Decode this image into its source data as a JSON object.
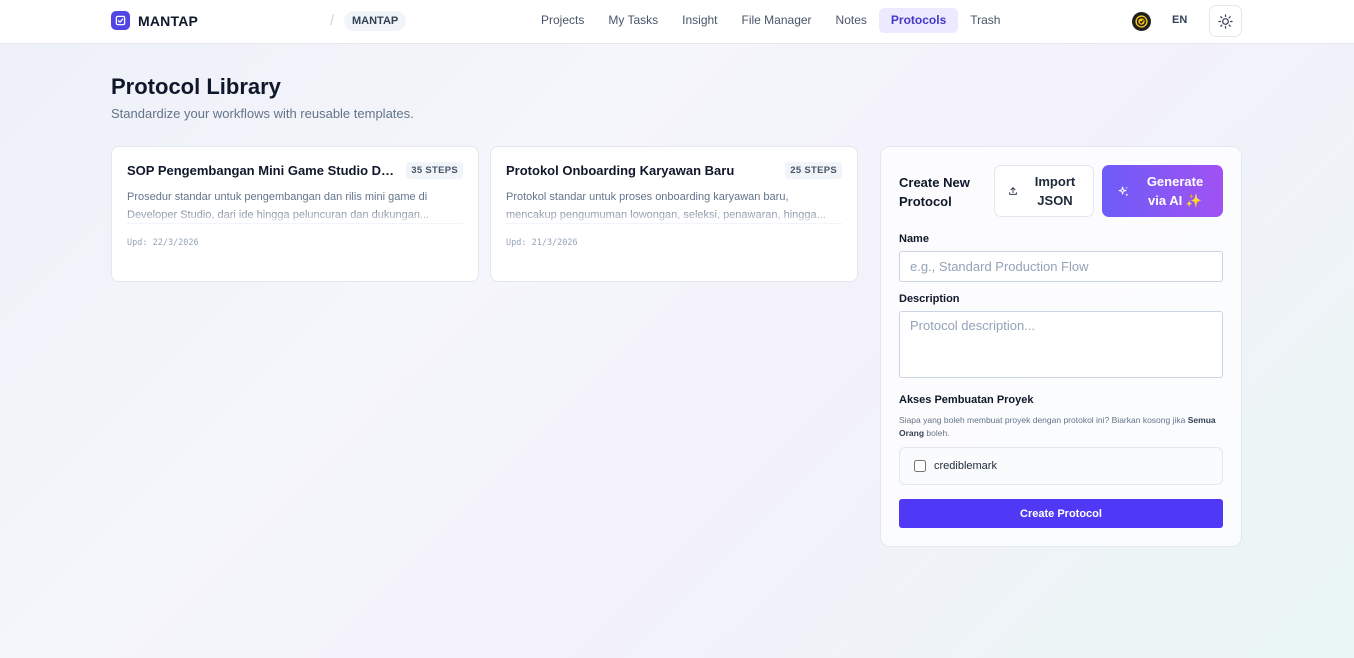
{
  "brand": {
    "name": "MANTAP"
  },
  "breadcrumb": {
    "separator": "/",
    "current": "MANTAP"
  },
  "nav": {
    "links": [
      "Projects",
      "My Tasks",
      "Insight",
      "File Manager",
      "Notes",
      "Protocols",
      "Trash"
    ],
    "active": "Protocols"
  },
  "topright": {
    "lang": "EN",
    "theme_icon": "sun-icon",
    "coin_icon": "coin-icon"
  },
  "header": {
    "title": "Protocol Library",
    "subtitle": "Standardize your workflows with reusable templates."
  },
  "protocols": [
    {
      "title": "SOP Pengembangan Mini Game Studio Developer",
      "steps": "35 STEPS",
      "description": "Prosedur standar untuk pengembangan dan rilis mini game di Developer Studio, dari ide hingga peluncuran dan dukungan...",
      "updated": "Upd: 22/3/2026"
    },
    {
      "title": "Protokol Onboarding Karyawan Baru",
      "steps": "25 STEPS",
      "description": "Protokol standar untuk proses onboarding karyawan baru, mencakup pengumuman lowongan, seleksi, penawaran, hingga...",
      "updated": "Upd: 21/3/2026"
    }
  ],
  "create": {
    "title": "Create New Protocol",
    "import_label": "Import JSON",
    "ai_label": "Generate via AI ✨",
    "name_label": "Name",
    "name_placeholder": "e.g., Standard Production Flow",
    "desc_label": "Description",
    "desc_placeholder": "Protocol description...",
    "access_title": "Akses Pembuatan Proyek",
    "access_help_pre": "Siapa yang boleh membuat proyek dengan protokol ini? Biarkan kosong jika",
    "access_help_bold": "Semua Orang",
    "access_help_post": "boleh.",
    "users": [
      {
        "name": "crediblemark",
        "checked": false
      }
    ],
    "submit_label": "Create Protocol"
  },
  "colors": {
    "accent": "#4f46e5",
    "primary_button": "#4f38f6",
    "ai_gradient_start": "#6d5cf6",
    "ai_gradient_end": "#a152f4"
  }
}
